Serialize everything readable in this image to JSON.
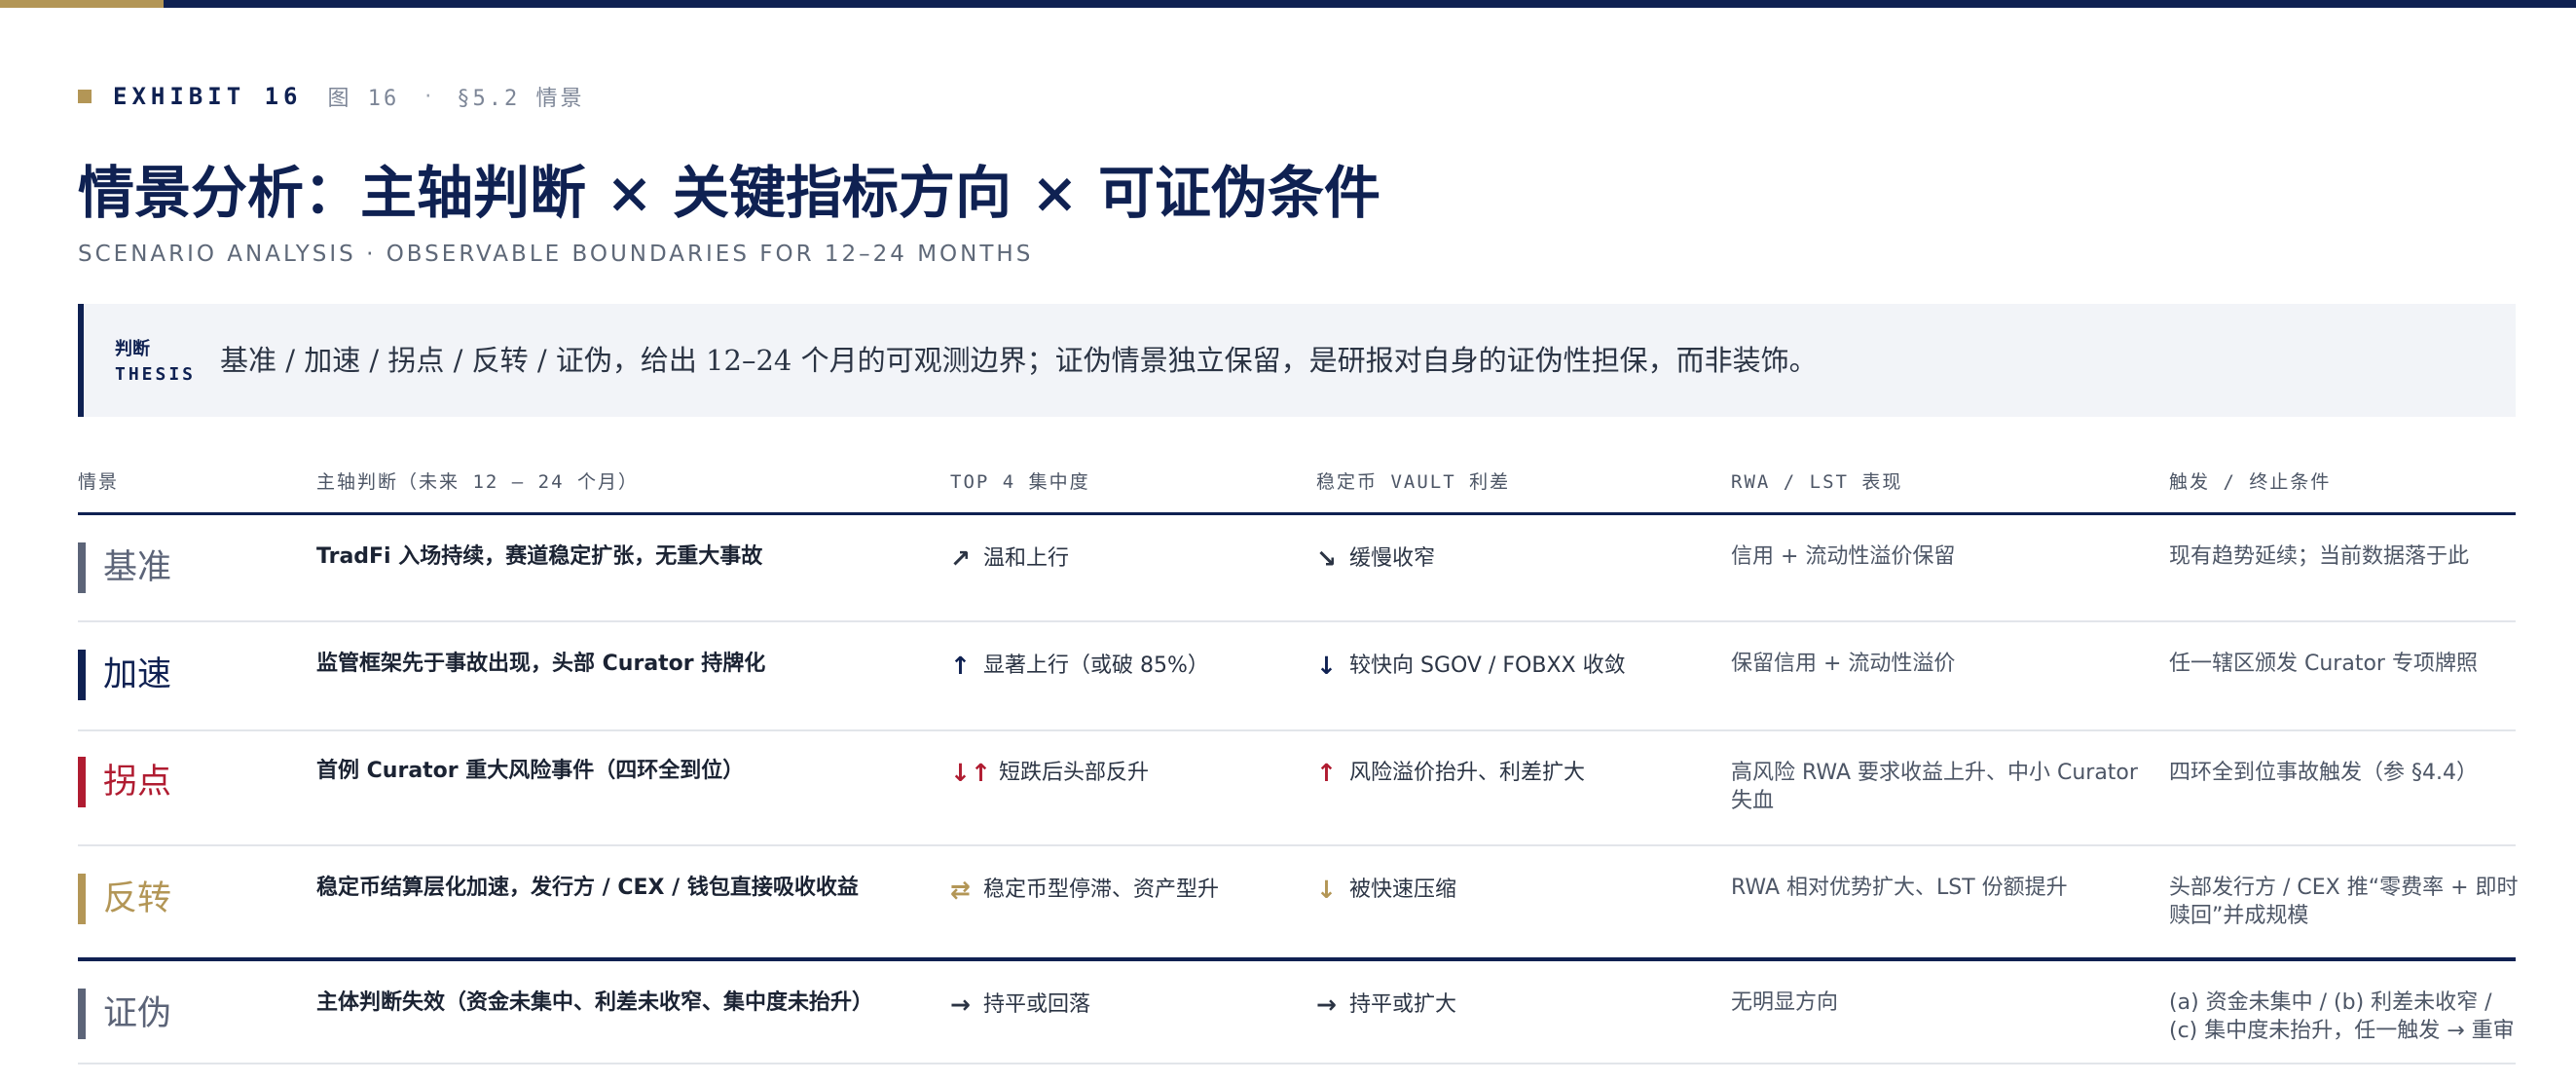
{
  "exhibit": {
    "label": "EXHIBIT 16",
    "fig": "图 16",
    "separator": "·",
    "section": "§5.2 情景"
  },
  "title": "情景分析：主轴判断 × 关键指标方向 × 可证伪条件",
  "subtitle": "SCENARIO ANALYSIS · OBSERVABLE BOUNDARIES FOR 12–24 MONTHS",
  "thesis": {
    "tag_cn": "判断",
    "tag_en": "THESIS",
    "text": "基准 / 加速 / 拐点 / 反转 / 证伪，给出 12–24 个月的可观测边界；证伪情景独立保留，是研报对自身的证伪性担保，而非装饰。"
  },
  "columns": [
    "情景",
    "主轴判断（未来 12 – 24 个月）",
    "TOP 4 集中度",
    "稳定币 VAULT 利差",
    "RWA / LST 表现",
    "触发 / 终止条件"
  ],
  "colors": {
    "navy": "#0f2152",
    "gold": "#b39656",
    "slate": "#5c6478",
    "crimson": "#b01c31",
    "accent_bar": "#b39656"
  },
  "rows": [
    {
      "scenario": "基准",
      "scenario_color": "#5c6478",
      "judgment": "TradFi 入场持续，赛道稳定扩张，无重大事故",
      "top4": {
        "icon": "arrow-up-right-icon",
        "arrow": "↗",
        "arrow_color": "#2b3444",
        "text": "温和上行"
      },
      "spread": {
        "icon": "arrow-down-right-icon",
        "arrow": "↘",
        "arrow_color": "#2b3444",
        "text": "缓慢收窄"
      },
      "rwa": "信用 + 流动性溢价保留",
      "trigger": "现有趋势延续；当前数据落于此"
    },
    {
      "scenario": "加速",
      "scenario_color": "#0f2152",
      "judgment": "监管框架先于事故出现，头部 Curator 持牌化",
      "top4": {
        "icon": "arrow-up-icon",
        "arrow": "↑",
        "arrow_color": "#0f2152",
        "text": "显著上行（或破 85%）"
      },
      "spread": {
        "icon": "arrow-down-icon",
        "arrow": "↓",
        "arrow_color": "#0f2152",
        "text": "较快向 SGOV / FOBXX 收敛"
      },
      "rwa": "保留信用 + 流动性溢价",
      "trigger": "任一辖区颁发 Curator 专项牌照"
    },
    {
      "scenario": "拐点",
      "scenario_color": "#b01c31",
      "judgment": "首例 Curator 重大风险事件（四环全到位）",
      "top4": {
        "icon": "arrow-down-up-icon",
        "arrow": "↓↑",
        "arrow_color": "#b01c31",
        "text": "短跌后头部反升"
      },
      "spread": {
        "icon": "arrow-up-icon",
        "arrow": "↑",
        "arrow_color": "#b01c31",
        "text": "风险溢价抬升、利差扩大"
      },
      "rwa": "高风险 RWA 要求收益上升、中小 Curator 失血",
      "trigger": "四环全到位事故触发（参 §4.4）"
    },
    {
      "scenario": "反转",
      "scenario_color": "#b39656",
      "judgment": "稳定币结算层化加速，发行方 / CEX / 钱包直接吸收收益",
      "top4": {
        "icon": "exchange-arrows-icon",
        "arrow": "⇄",
        "arrow_color": "#b39656",
        "text": "稳定币型停滞、资产型升"
      },
      "spread": {
        "icon": "arrow-down-icon",
        "arrow": "↓",
        "arrow_color": "#b39656",
        "text": "被快速压缩"
      },
      "rwa": "RWA 相对优势扩大、LST 份额提升",
      "trigger": "头部发行方 / CEX 推“零费率 + 即时赎回”并成规模"
    },
    {
      "scenario": "证伪",
      "scenario_color": "#5c6478",
      "judgment": "主体判断失效（资金未集中、利差未收窄、集中度未抬升）",
      "top4": {
        "icon": "arrow-right-icon",
        "arrow": "→",
        "arrow_color": "#2b3444",
        "text": "持平或回落"
      },
      "spread": {
        "icon": "arrow-right-icon",
        "arrow": "→",
        "arrow_color": "#2b3444",
        "text": "持平或扩大"
      },
      "rwa": "无明显方向",
      "trigger": "(a) 资金未集中 / (b) 利差未收窄 / (c) 集中度未抬升，任一触发 → 重审"
    }
  ]
}
